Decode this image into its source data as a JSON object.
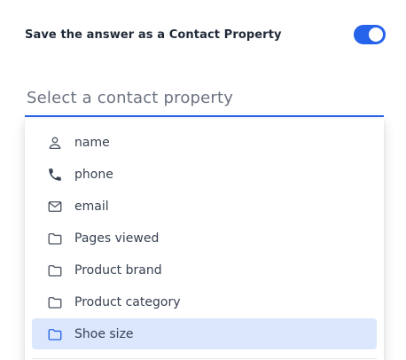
{
  "save_setting": {
    "label": "Save the answer as a Contact Property",
    "toggle_on": true,
    "toggle_color": "#2563eb"
  },
  "property_select": {
    "placeholder": "Select a contact property",
    "accent_color": "#2563eb"
  },
  "options": [
    {
      "label": "name",
      "icon": "person-icon",
      "selected": false
    },
    {
      "label": "phone",
      "icon": "phone-icon",
      "selected": false
    },
    {
      "label": "email",
      "icon": "mail-icon",
      "selected": false
    },
    {
      "label": "Pages viewed",
      "icon": "folder-icon",
      "selected": false
    },
    {
      "label": "Product brand",
      "icon": "folder-icon",
      "selected": false
    },
    {
      "label": "Product category",
      "icon": "folder-icon",
      "selected": false
    },
    {
      "label": "Shoe size",
      "icon": "folder-icon",
      "selected": true
    }
  ],
  "highlight_color": "#dbe7fd"
}
